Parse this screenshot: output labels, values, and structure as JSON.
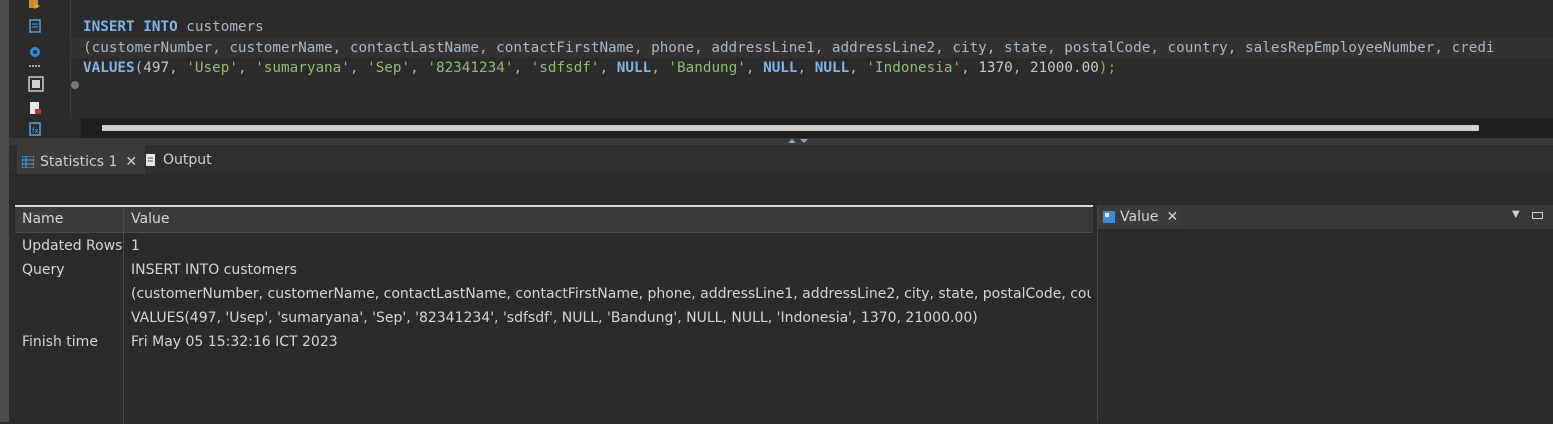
{
  "editor": {
    "line1": {
      "kw": "INSERT INTO",
      "rest": " customers"
    },
    "line2": "(customerNumber, customerName, contactLastName, contactFirstName, phone, addressLine1, addressLine2, city, state, postalCode, country, salesRepEmployeeNumber, credi",
    "line3": {
      "kw": "VALUES",
      "open": "(",
      "v1": "497",
      "v2": "'Usep'",
      "v3": "'sumaryana'",
      "v4": "'Sep'",
      "v5": "'82341234'",
      "v6": "'sdfsdf'",
      "v7": "NULL",
      "v8": "'Bandung'",
      "v9": "NULL",
      "v10": "NULL",
      "v11": "'Indonesia'",
      "v12": "1370",
      "v13": "21000.00",
      "close": ");"
    }
  },
  "tabs": {
    "statistics": "Statistics 1",
    "output": "Output"
  },
  "grid": {
    "headers": {
      "name": "Name",
      "value": "Value"
    },
    "rows": [
      {
        "name": "Updated Rows",
        "value": "1"
      },
      {
        "name": "Query",
        "value": "INSERT INTO customers"
      },
      {
        "name": "",
        "value": "(customerNumber, customerName, contactLastName, contactFirstName, phone, addressLine1, addressLine2, city, state, postalCode, country, salesR"
      },
      {
        "name": "",
        "value": "VALUES(497, 'Usep', 'sumaryana', 'Sep', '82341234', 'sdfsdf', NULL, 'Bandung', NULL, NULL, 'Indonesia', 1370, 21000.00)"
      },
      {
        "name": "Finish time",
        "value": "Fri May 05 15:32:16 ICT 2023"
      }
    ]
  },
  "value_panel": {
    "title": "Value"
  },
  "colors": {
    "keyword": "#7eb4ea",
    "string": "#8fbf6a",
    "background": "#2b2b2b"
  }
}
